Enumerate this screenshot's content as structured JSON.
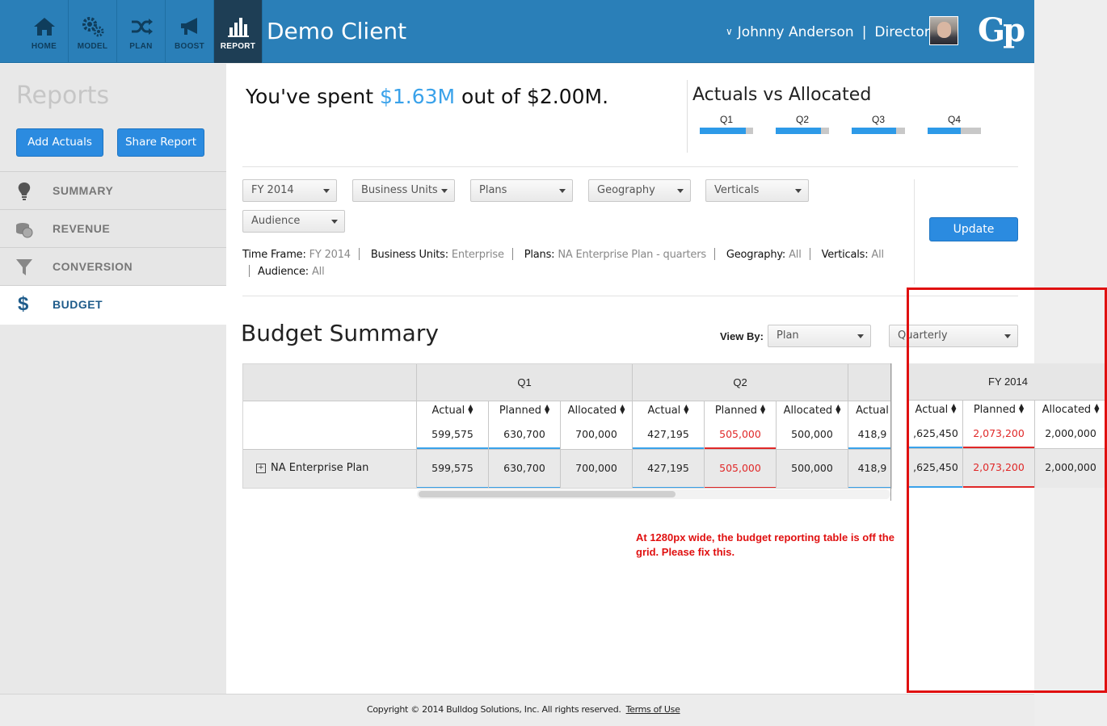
{
  "nav": {
    "items": [
      {
        "label": "HOME",
        "icon": "home-icon"
      },
      {
        "label": "MODEL",
        "icon": "gears-icon"
      },
      {
        "label": "PLAN",
        "icon": "shuffle-icon"
      },
      {
        "label": "BOOST",
        "icon": "megaphone-icon"
      },
      {
        "label": "REPORT",
        "icon": "bar-chart-icon",
        "active": true
      }
    ],
    "client": "Demo Client",
    "user_name": "Johnny Anderson",
    "user_role": "Director",
    "logo": "Gp"
  },
  "sidebar": {
    "title": "Reports",
    "add_actuals": "Add Actuals",
    "share_report": "Share Report",
    "items": [
      {
        "label": "SUMMARY",
        "icon": "lightbulb-icon"
      },
      {
        "label": "REVENUE",
        "icon": "coins-icon"
      },
      {
        "label": "CONVERSION",
        "icon": "funnel-icon"
      },
      {
        "label": "BUDGET",
        "icon": "dollar-icon",
        "active": true
      }
    ]
  },
  "summary": {
    "spent_prefix": "You've spent ",
    "spent_amount": "$1.63M",
    "spent_suffix": " out of $2.00M."
  },
  "avs": {
    "title": "Actuals vs Allocated",
    "quarters": [
      {
        "label": "Q1",
        "fill": 0.86
      },
      {
        "label": "Q2",
        "fill": 0.85
      },
      {
        "label": "Q3",
        "fill": 0.84
      },
      {
        "label": "Q4",
        "fill": 0.62
      }
    ]
  },
  "filters": {
    "fy": "FY 2014",
    "business_units": "Business Units",
    "plans": "Plans",
    "geography": "Geography",
    "verticals": "Verticals",
    "audience": "Audience",
    "update": "Update",
    "timeframe": {
      "tf_label": "Time Frame:",
      "tf_value": "FY 2014",
      "bu_label": "Business Units:",
      "bu_value": "Enterprise",
      "plans_label": "Plans:",
      "plans_value": "NA Enterprise Plan - quarters",
      "geo_label": "Geography:",
      "geo_value": "All",
      "vert_label": "Verticals:",
      "vert_value": "All",
      "aud_label": "Audience:",
      "aud_value": "All"
    }
  },
  "budget": {
    "title": "Budget Summary",
    "view_by_label": "View By:",
    "view_by_value": "Plan",
    "period_value": "Quarterly",
    "groups": [
      "Q1",
      "Q2"
    ],
    "columns": [
      "Actual",
      "Planned",
      "Allocated",
      "Actual",
      "Planned",
      "Allocated",
      "Actual"
    ],
    "totals": [
      "599,575",
      "630,700",
      "700,000",
      "427,195",
      "505,000",
      "500,000",
      "418,9"
    ],
    "row_name": "NA Enterprise Plan",
    "row_values": [
      "599,575",
      "630,700",
      "700,000",
      "427,195",
      "505,000",
      "500,000",
      "418,9"
    ],
    "fy_group": "FY 2014",
    "fy_columns": [
      "Actual",
      "Planned",
      "Allocated"
    ],
    "fy_totals": [
      ",625,450",
      "2,073,200",
      "2,000,000"
    ],
    "fy_row": [
      ",625,450",
      "2,073,200",
      "2,000,000"
    ],
    "fy_first_col_partial": "Actua"
  },
  "annotation": {
    "text": "At 1280px wide, the budget reporting table is off the grid. Please fix this."
  },
  "footer": {
    "copyright": "Copyright © 2014 Bulldog Solutions, Inc. All rights reserved.",
    "terms": "Terms of Use"
  },
  "colors": {
    "topbar": "#2a7fb8",
    "accent": "#3aa2ea",
    "over_budget": "#e02828",
    "annotation": "#e01010"
  }
}
